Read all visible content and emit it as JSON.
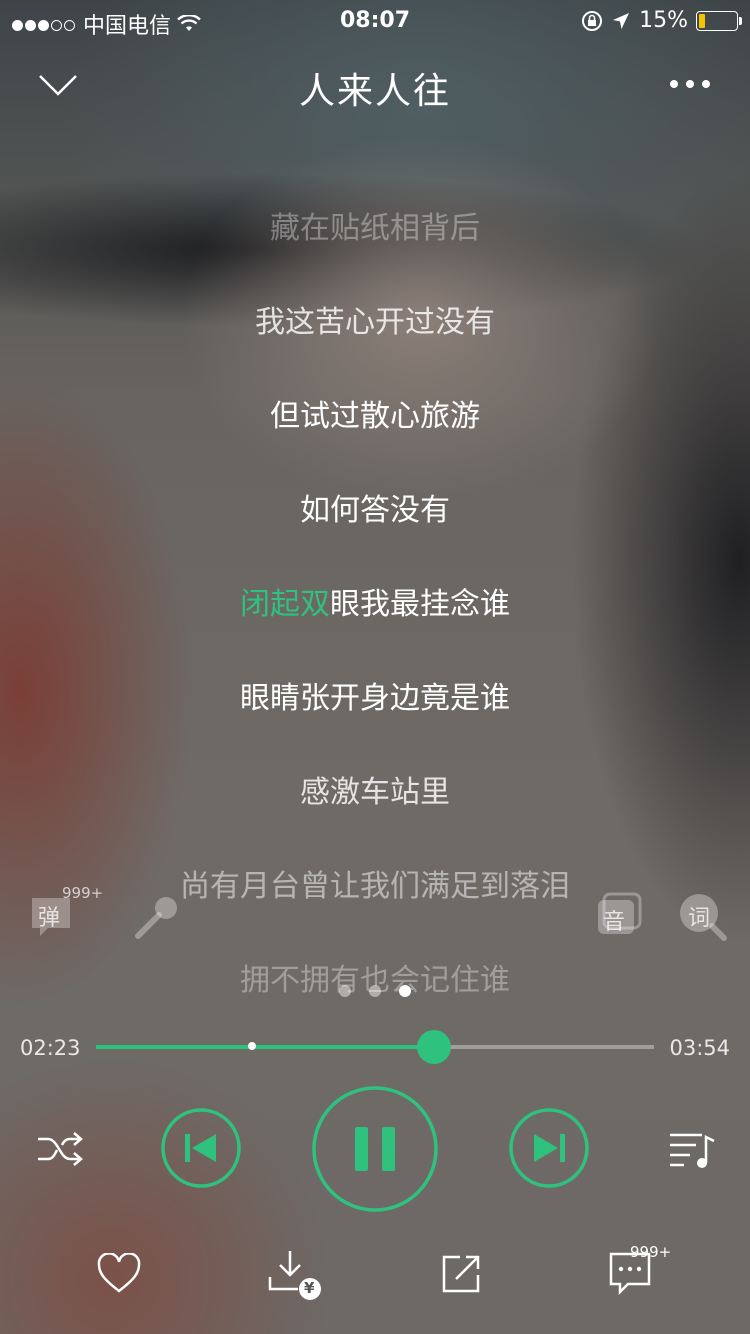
{
  "status_bar": {
    "carrier": "中国电信",
    "time": "08:07",
    "battery": "15%"
  },
  "nav": {
    "title": "人来人往"
  },
  "lyrics": {
    "lines": [
      "藏在贴纸相背后",
      "我这苦心开过没有",
      "但试过散心旅游",
      "如何答没有",
      "眼睛张开身边竟是谁",
      "感激车站里",
      "尚有月台曾让我们满足到落泪",
      "拥不拥有也会记住谁"
    ],
    "current_played": "闭起双",
    "current_rest": "眼我最挂念谁"
  },
  "side": {
    "danmu_label": "弹",
    "danmu_count": "999+",
    "sound_label": "音",
    "lyric_label": "词"
  },
  "player": {
    "current_time": "02:23",
    "total_time": "03:54",
    "progress": 0.606,
    "buffered": 0.28
  },
  "bottom": {
    "comment_count": "999+",
    "price_badge": "¥"
  },
  "colors": {
    "accent": "#2ec27e"
  }
}
